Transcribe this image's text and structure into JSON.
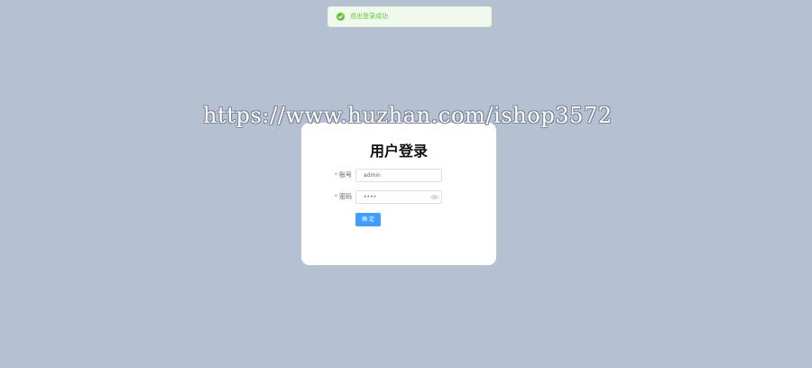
{
  "toast": {
    "message": "退出登录成功",
    "icon": "success-check-icon",
    "color": "#67c23a"
  },
  "watermark": {
    "text": "https://www.huzhan.com/ishop3572"
  },
  "login": {
    "title": "用户登录",
    "account": {
      "required_mark": "*",
      "label": "账号",
      "value": "admin"
    },
    "password": {
      "required_mark": "*",
      "label": "密码",
      "value": "••••",
      "toggle_icon": "eye-icon"
    },
    "submit_label": "确 定"
  },
  "colors": {
    "background": "#b5c1d3",
    "card": "#ffffff",
    "primary": "#409eff",
    "success": "#67c23a",
    "required": "#f56c6c"
  }
}
